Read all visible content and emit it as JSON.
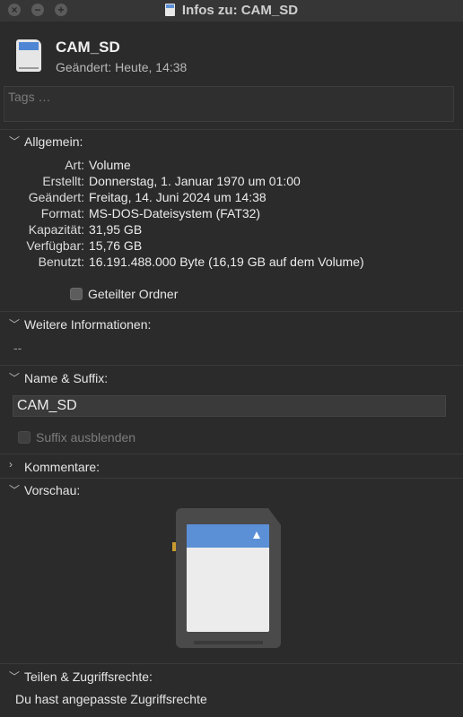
{
  "window": {
    "title": "Infos zu: CAM_SD",
    "buttons": {
      "close": "×",
      "minimize": "−",
      "zoom": "+"
    }
  },
  "header": {
    "name": "CAM_SD",
    "modified": "Geändert: Heute, 14:38"
  },
  "tags": {
    "placeholder": "Tags …"
  },
  "general": {
    "title": "Allgemein:",
    "rows": [
      {
        "key": "Art:",
        "value": "Volume"
      },
      {
        "key": "Erstellt:",
        "value": "Donnerstag, 1. Januar 1970 um 01:00"
      },
      {
        "key": "Geändert:",
        "value": "Freitag, 14. Juni 2024 um 14:38"
      },
      {
        "key": "Format:",
        "value": "MS-DOS-Dateisystem (FAT32)"
      },
      {
        "key": "Kapazität:",
        "value": "31,95 GB"
      },
      {
        "key": "Verfügbar:",
        "value": "15,76 GB"
      },
      {
        "key": "Benutzt:",
        "value": "16.191.488.000 Byte (16,19 GB auf dem Volume)"
      }
    ],
    "shared_folder_label": "Geteilter Ordner"
  },
  "more_info": {
    "title": "Weitere Informationen:",
    "value": "--"
  },
  "name_suffix": {
    "title": "Name & Suffix:",
    "name_value": "CAM_SD",
    "hide_extension_label": "Suffix ausblenden"
  },
  "comments": {
    "title": "Kommentare:"
  },
  "preview": {
    "title": "Vorschau:"
  },
  "sharing": {
    "title": "Teilen & Zugriffsrechte:",
    "text": "Du hast angepasste Zugriffsrechte"
  },
  "icons": {
    "disclosure_open": "chevron-down-icon",
    "disclosure_closed": "chevron-right-icon",
    "preview": "sd-card-icon"
  },
  "colors": {
    "background": "#2b2b2b",
    "accent": "#5b8fd6"
  }
}
